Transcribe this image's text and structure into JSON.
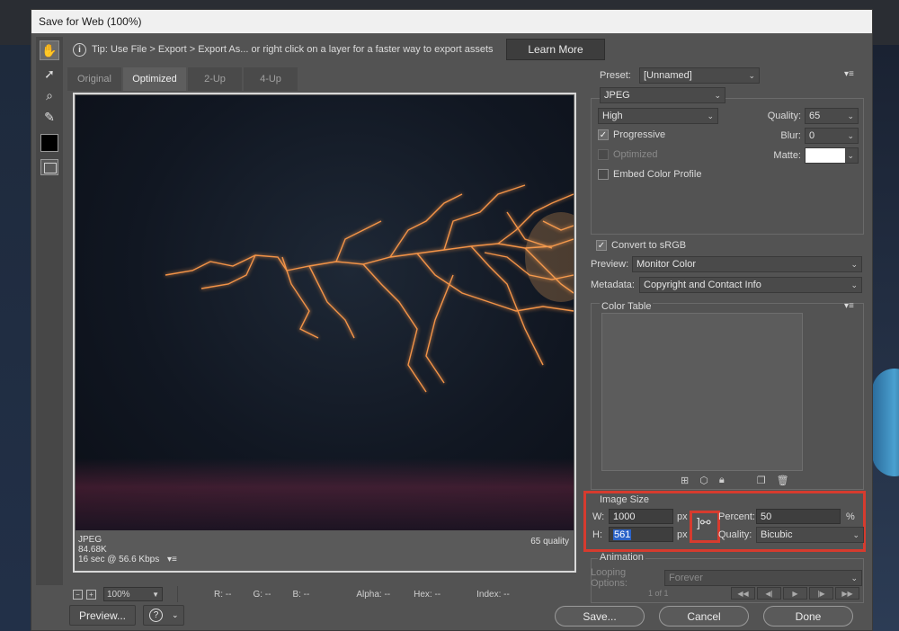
{
  "dialog": {
    "title": "Save for Web (100%)"
  },
  "tip": {
    "text": "Tip: Use File > Export > Export As...  or right click on a layer for a faster way to export assets",
    "learn_more": "Learn More"
  },
  "tabs": [
    "Original",
    "Optimized",
    "2-Up",
    "4-Up"
  ],
  "preview_info": {
    "format": "JPEG",
    "size": "84.68K",
    "time": "16 sec @ 56.6 Kbps",
    "quality": "65 quality"
  },
  "status": {
    "zoom": "100%",
    "r": "R: --",
    "g": "G: --",
    "b": "B: --",
    "alpha": "Alpha: --",
    "hex": "Hex: --",
    "index": "Index: --"
  },
  "bottom_buttons": {
    "preview": "Preview...",
    "help_glyph": "?",
    "save": "Save...",
    "cancel": "Cancel",
    "done": "Done"
  },
  "settings": {
    "preset_label": "Preset:",
    "preset_value": "[Unnamed]",
    "format": "JPEG",
    "quality_preset": "High",
    "quality_label": "Quality:",
    "quality_value": "65",
    "blur_label": "Blur:",
    "blur_value": "0",
    "matte_label": "Matte:",
    "matte_color": "#ffffff",
    "progressive": "Progressive",
    "optimized": "Optimized",
    "embed_profile": "Embed Color Profile",
    "convert_srgb": "Convert to sRGB",
    "preview_label": "Preview:",
    "preview_value": "Monitor Color",
    "metadata_label": "Metadata:",
    "metadata_value": "Copyright and Contact Info"
  },
  "color_table": {
    "title": "Color Table"
  },
  "image_size": {
    "title": "Image Size",
    "w_label": "W:",
    "w_value": "1000",
    "h_label": "H:",
    "h_value": "561",
    "unit": "px",
    "percent_label": "Percent:",
    "percent_value": "50",
    "percent_unit": "%",
    "quality_label": "Quality:",
    "quality_value": "Bicubic"
  },
  "animation": {
    "title": "Animation",
    "looping_label": "Looping Options:",
    "looping_value": "Forever",
    "frame": "1 of 1"
  },
  "colors": {
    "highlight": "#d63b2e",
    "bolt": "#ff9a4a"
  }
}
